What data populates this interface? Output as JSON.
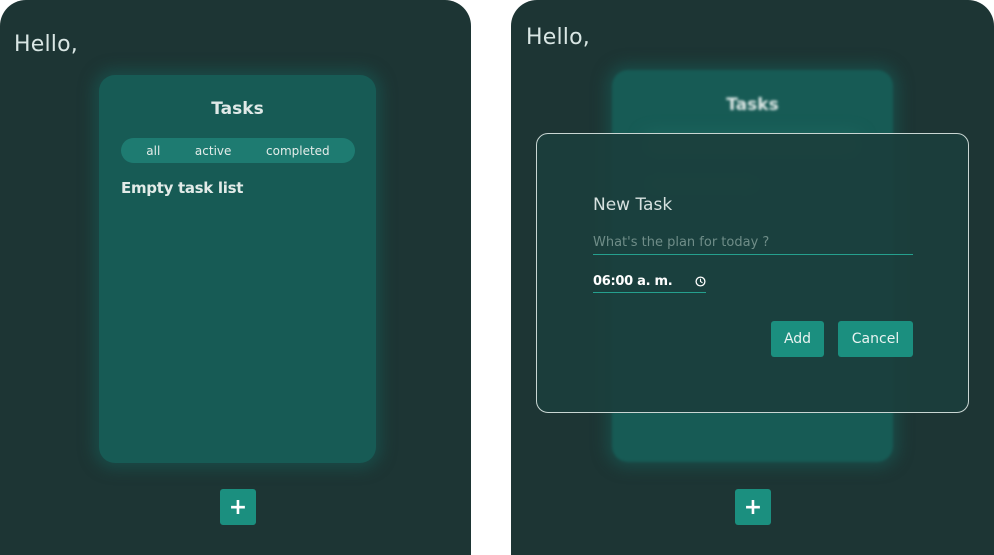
{
  "left_screen": {
    "greeting": "Hello,",
    "tasks_card": {
      "title": "Tasks",
      "filters": [
        "all",
        "active",
        "completed"
      ],
      "empty_message": "Empty task list"
    },
    "add_button_label": "+"
  },
  "right_screen": {
    "greeting": "Hello,",
    "tasks_card": {
      "title": "Tasks"
    },
    "add_button_label": "+",
    "modal": {
      "title": "New Task",
      "task_input": {
        "value": "",
        "placeholder": "What's the plan for today ?"
      },
      "time_value": "06:00 a. m.",
      "add_label": "Add",
      "cancel_label": "Cancel"
    }
  },
  "icons": {
    "time_field": "clock-icon",
    "add_fab": "plus-icon"
  },
  "colors": {
    "background": "#1d3534",
    "card": "#175b55",
    "accent": "#1b8f7f",
    "text": "#d9e6e4"
  }
}
